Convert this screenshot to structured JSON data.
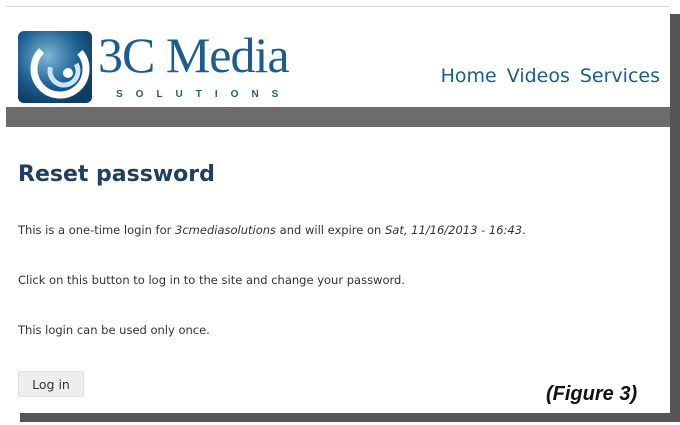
{
  "logo": {
    "name": "3C Media",
    "tagline": "SOLUTIONS"
  },
  "nav": {
    "items": [
      "Home",
      "Videos",
      "Services"
    ]
  },
  "colors": {
    "brand": "#1c5d8e",
    "nav_bar": "#6c6c6c",
    "title": "#1e3f5f"
  },
  "page": {
    "title": "Reset password",
    "line1_prefix": "This is a one-time login for ",
    "line1_site": "3cmediasolutions",
    "line1_middle": " and will expire on ",
    "line1_expiry": "Sat, 11/16/2013 - 16:43",
    "line1_suffix": ".",
    "line2": "Click on this button to log in to the site and change your password.",
    "line3": "This login can be used only once.",
    "login_button": "Log in"
  },
  "figure_label": "(Figure 3)"
}
